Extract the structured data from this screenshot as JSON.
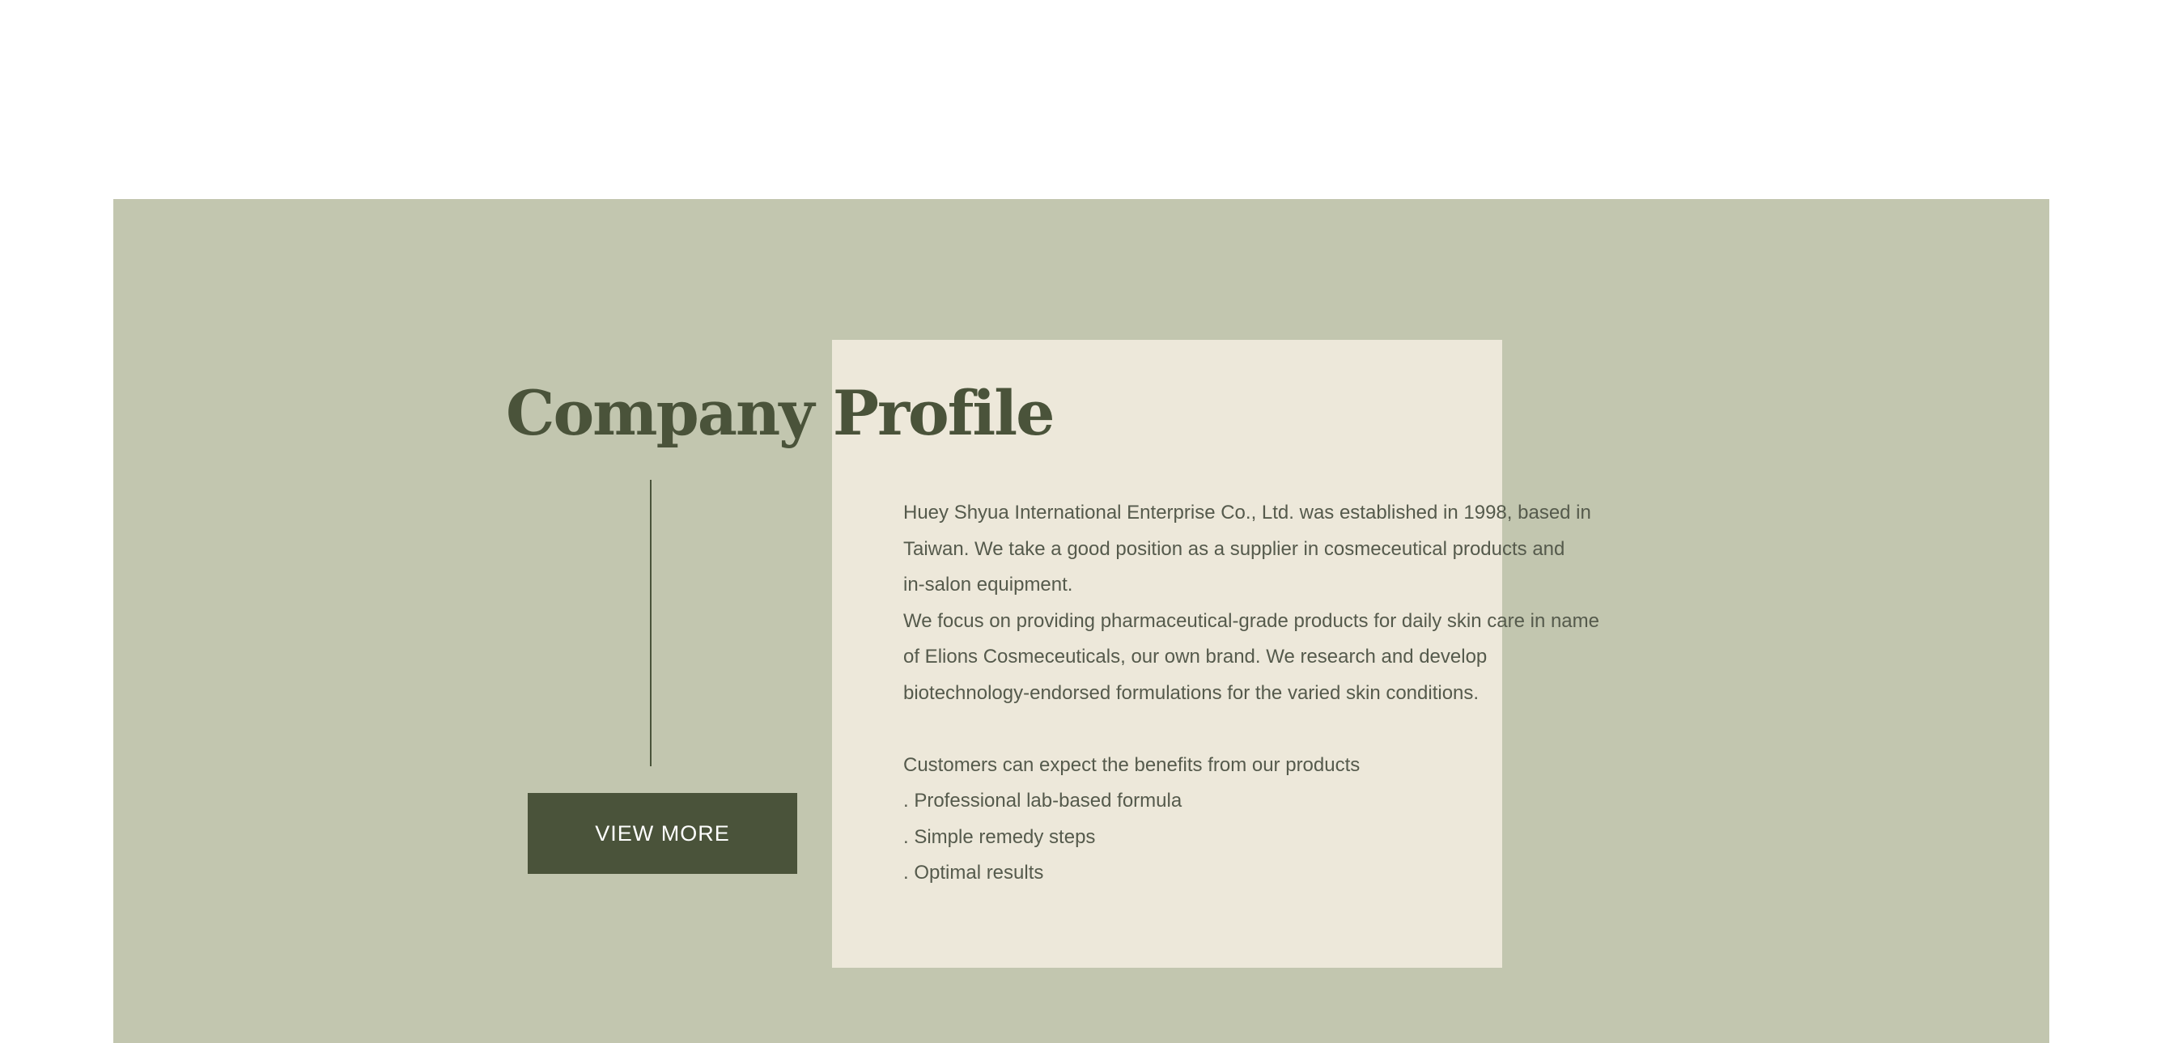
{
  "profile": {
    "title": "Company Profile",
    "button_label": "VIEW MORE",
    "paragraph_lines": [
      "Huey Shyua International Enterprise Co., Ltd. was established in 1998, based in",
      "Taiwan. We take a good position as a supplier in cosmeceutical products and",
      "in-salon equipment.",
      "We focus on providing pharmaceutical-grade products for daily skin care in name",
      "of Elions Cosmeceuticals, our own brand. We research and develop",
      "biotechnology-endorsed formulations for the varied skin conditions."
    ],
    "benefits_heading": "Customers can expect the benefits from our products",
    "benefits": [
      ". Professional lab-based formula",
      ". Simple remedy steps",
      ". Optimal results"
    ]
  },
  "colors": {
    "section_background": "#c2c6af",
    "panel_background": "#ede8da",
    "accent_dark_green": "#4a533a",
    "body_text": "#555a4c"
  }
}
